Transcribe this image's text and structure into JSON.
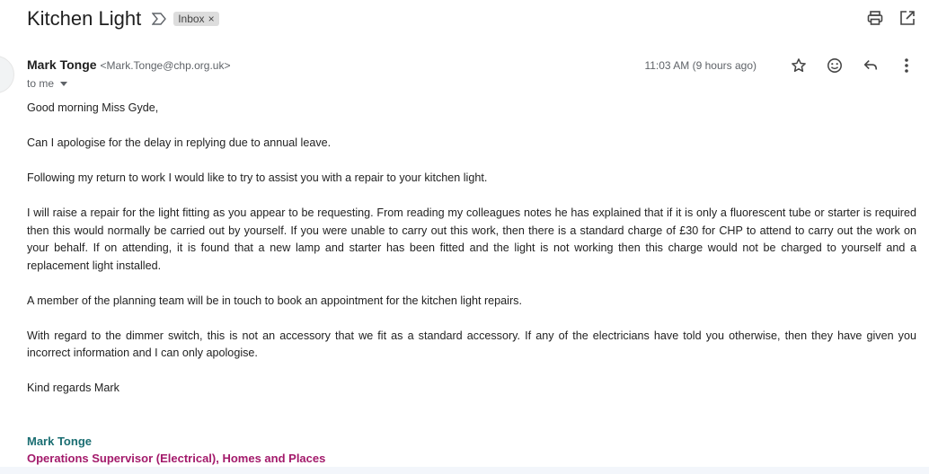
{
  "email": {
    "subject": "Kitchen Light",
    "label": "Inbox",
    "label_remove": "×",
    "sender_name": "Mark Tonge",
    "sender_email": "<Mark.Tonge@chp.org.uk>",
    "to": "to me",
    "timestamp": "11:03 AM (9 hours ago)",
    "body": [
      "Good morning Miss Gyde,",
      "Can I apologise for the delay in replying due to annual leave.",
      "Following my return to work I would like to try to assist you with a repair to your kitchen light.",
      "I will raise a repair for the light fitting as you appear to be requesting. From reading my colleagues notes he has explained that if it is only a fluorescent tube or starter is required then this would normally be carried out by yourself. If you were unable to carry out this work, then there is a standard charge of £30 for CHP to attend to carry out the work on your behalf. If on attending, it is found that a new lamp and starter has been fitted and the light is not working then this charge would not be charged to yourself and a replacement light installed.",
      "A member of the planning team will be in touch to book an appointment for the kitchen light repairs.",
      "With regard to the dimmer switch, this is not an accessory that we fit as a standard accessory. If any of the electricians have told you otherwise, then they have given you incorrect information and I can only apologise.",
      "Kind regards Mark"
    ],
    "signature": {
      "name": "Mark Tonge",
      "title": "Operations Supervisor (Electrical), Homes and Places"
    }
  },
  "icons": {
    "important": "important-marker-icon",
    "print": "print-icon",
    "open_new_window": "open-in-new-window-icon",
    "star": "star-icon",
    "emoji": "emoji-reaction-icon",
    "reply": "reply-icon",
    "more": "more-vertical-icon"
  },
  "colors": {
    "signature_name": "#1b6e72",
    "signature_title": "#a31a6b"
  }
}
